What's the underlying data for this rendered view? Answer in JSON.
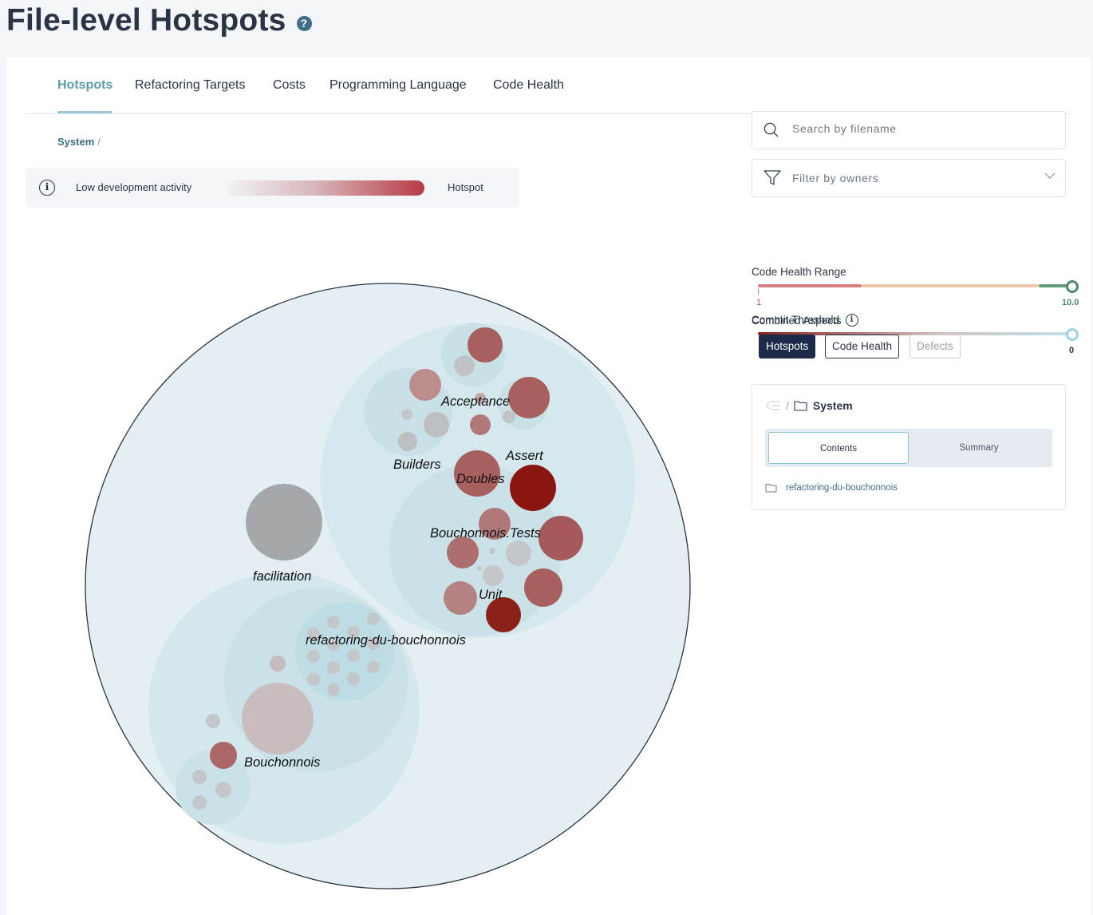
{
  "page": {
    "title": "File-level Hotspots",
    "help_glyph": "?"
  },
  "tabs": [
    {
      "label": "Hotspots",
      "active": true
    },
    {
      "label": "Refactoring Targets"
    },
    {
      "label": "Costs"
    },
    {
      "label": "Programming Language"
    },
    {
      "label": "Code Health"
    }
  ],
  "breadcrumb": {
    "root": "System",
    "separator": "/"
  },
  "legend": {
    "info_glyph": "i",
    "low_label": "Low development activity",
    "high_label": "Hotspot",
    "gradient_colors": [
      "#f1f3f5",
      "#d7b6bb",
      "#b83a43"
    ]
  },
  "visualization": {
    "labels": {
      "acceptance": "Acceptance",
      "builders": "Builders",
      "assert": "Assert",
      "doubles": "Doubles",
      "tests": "Bouchonnois.Tests",
      "facilitation": "facilitation",
      "unit": "Unit",
      "root_folder": "refactoring-du-bouchonnois",
      "bouchonnois": "Bouchonnois"
    },
    "colors": {
      "pack_fill": "#e3eff2",
      "pack_inner": "#d0e6eb",
      "hotspot_high": "#8a1610",
      "hotspot_mid": "#a8605f",
      "neutral": "#a7a9ab",
      "low": "#c6cacc"
    }
  },
  "search": {
    "placeholder": "Search by filename",
    "icon": "search-icon"
  },
  "filter": {
    "placeholder": "Filter by owners",
    "icon": "filter-icon"
  },
  "code_health_range": {
    "label": "Code Health Range",
    "min_label": "1",
    "max_label": "10.0",
    "min": 1,
    "max": 10.0
  },
  "commit_threshold": {
    "label": "Commit Threshold",
    "value_label": "0",
    "value": 0
  },
  "combined_aspects": {
    "label": "Combined Aspects",
    "info_glyph": "i",
    "buttons": [
      {
        "label": "Hotspots",
        "state": "active"
      },
      {
        "label": "Code Health",
        "state": "inactive"
      },
      {
        "label": "Defects",
        "state": "disabled"
      }
    ]
  },
  "navigator": {
    "separator": "/",
    "current": "System",
    "tabs": {
      "contents": "Contents",
      "summary": "Summary"
    },
    "entries": [
      "refactoring-du-bouchonnois"
    ]
  }
}
